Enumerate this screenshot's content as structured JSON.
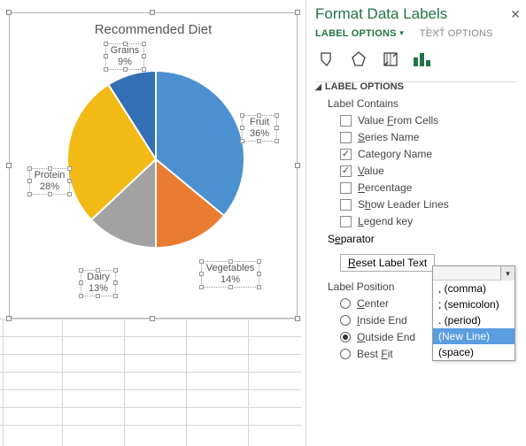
{
  "panel": {
    "title": "Format Data Labels",
    "tab_label_options": "LABEL OPTIONS",
    "tab_text_options": "TEXT OPTIONS",
    "section_header": "LABEL OPTIONS",
    "label_contains": "Label Contains",
    "opt_value_from_cells": "Value From Cells",
    "opt_series_name": "Series Name",
    "opt_category_name": "Category Name",
    "opt_value": "Value",
    "opt_percentage": "Percentage",
    "opt_show_leader": "Show Leader Lines",
    "opt_legend_key": "Legend key",
    "separator_label": "Separator",
    "reset_btn": "Reset Label Text",
    "label_position": "Label Position",
    "pos_center": "Center",
    "pos_inside_end": "Inside End",
    "pos_outside_end": "Outside End",
    "pos_best_fit": "Best Fit",
    "pos_selected": "outside_end",
    "checked": {
      "category_name": true,
      "value": true
    },
    "separator_options": [
      ", (comma)",
      "; (semicolon)",
      ". (period)",
      "(New Line)",
      "  (space)"
    ],
    "separator_selected_index": 3
  },
  "chart_data": {
    "type": "pie",
    "title": "Recommended Diet",
    "categories": [
      "Fruit",
      "Vegetables",
      "Dairy",
      "Protein",
      "Grains"
    ],
    "values": [
      36,
      14,
      13,
      28,
      9
    ],
    "colors": [
      "#4b90d0",
      "#e97c30",
      "#a2a2a2",
      "#f3b915",
      "#326fb5"
    ],
    "label_format": "category\\nvalue%",
    "data_label_position": "Outside End"
  },
  "chart_labels": {
    "fruit_cat": "Fruit",
    "fruit_val": "36%",
    "veg_cat": "Vegetables",
    "veg_val": "14%",
    "dairy_cat": "Dairy",
    "dairy_val": "13%",
    "protein_cat": "Protein",
    "protein_val": "28%",
    "grains_cat": "Grains",
    "grains_val": "9%"
  }
}
